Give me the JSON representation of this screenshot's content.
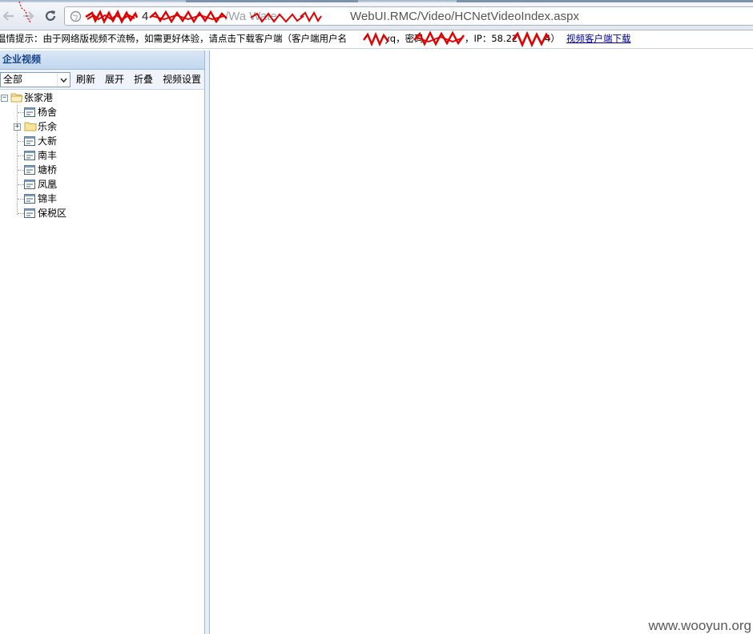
{
  "browser": {
    "url_host_visible": "4",
    "url_path_visible": "WebUI.RMC/Video/HCNetVideoIndex.aspx",
    "url_path_mid": "/Wa       Wate    ",
    "nav_icons": [
      "back-arrow-icon",
      "forward-arrow-icon",
      "reload-icon"
    ]
  },
  "notice": {
    "prefix": "女",
    "message": "温情提示：由于网络版视频不流畅，如需更好体验，请点击下载客户端（客户端用户名",
    "username_tail": "yq，密码",
    "ip_label": "，IP：58.22",
    "ip_tail": "4）",
    "download_link": "视频客户端下载"
  },
  "left_panel": {
    "title": "企业视频",
    "area_select": {
      "selected": "全部"
    },
    "buttons": {
      "refresh": "刷新",
      "expand": "展开",
      "collapse": "折叠",
      "settings": "视频设置"
    },
    "tree": {
      "root": {
        "label": "张家港",
        "icon": "folder-open-icon",
        "expanded": true
      },
      "children": [
        {
          "label": "杨舍",
          "icon": "camera-node-icon",
          "has_children": false
        },
        {
          "label": "乐余",
          "icon": "folder-icon",
          "has_children": true
        },
        {
          "label": "大新",
          "icon": "camera-node-icon",
          "has_children": false
        },
        {
          "label": "南丰",
          "icon": "camera-node-icon",
          "has_children": false
        },
        {
          "label": "塘桥",
          "icon": "camera-node-icon",
          "has_children": false
        },
        {
          "label": "凤凰",
          "icon": "camera-node-icon",
          "has_children": false
        },
        {
          "label": "锦丰",
          "icon": "camera-node-icon",
          "has_children": false
        },
        {
          "label": "保税区",
          "icon": "camera-node-icon",
          "has_children": false
        }
      ]
    }
  },
  "watermark": "www.wooyun.org",
  "colors": {
    "link": "#000099",
    "panel_title": "#15428b",
    "redaction": "#e00000"
  }
}
